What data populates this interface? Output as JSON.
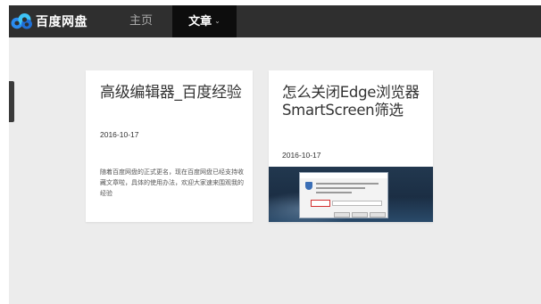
{
  "navbar": {
    "brand": {
      "icon": "baidu-netdisk-cloud-icon",
      "name": "百度网盘"
    },
    "items": [
      {
        "label": "主页",
        "active": false
      },
      {
        "label": "文章",
        "active": true,
        "chevron": "⌄"
      }
    ]
  },
  "articles": [
    {
      "title": "高级编辑器_百度经验",
      "date": "2016-10-17",
      "excerpt": "随着百度网盘的正式更名，现在百度网盘已经支持收藏文章啦，具体的使用办法，欢迎大家速来围观我的经验"
    },
    {
      "title": "怎么关闭Edge浏览器SmartScreen筛选",
      "date": "2016-10-17",
      "thumbnail": "windows-smartscreen-dialog-screenshot"
    }
  ],
  "colors": {
    "navbar_bg": "#2f2f2f",
    "nav_active_bg": "#0d0d0d",
    "page_bg": "#ececec",
    "card_bg": "#ffffff",
    "brand_blue": "#2b8cf0"
  }
}
